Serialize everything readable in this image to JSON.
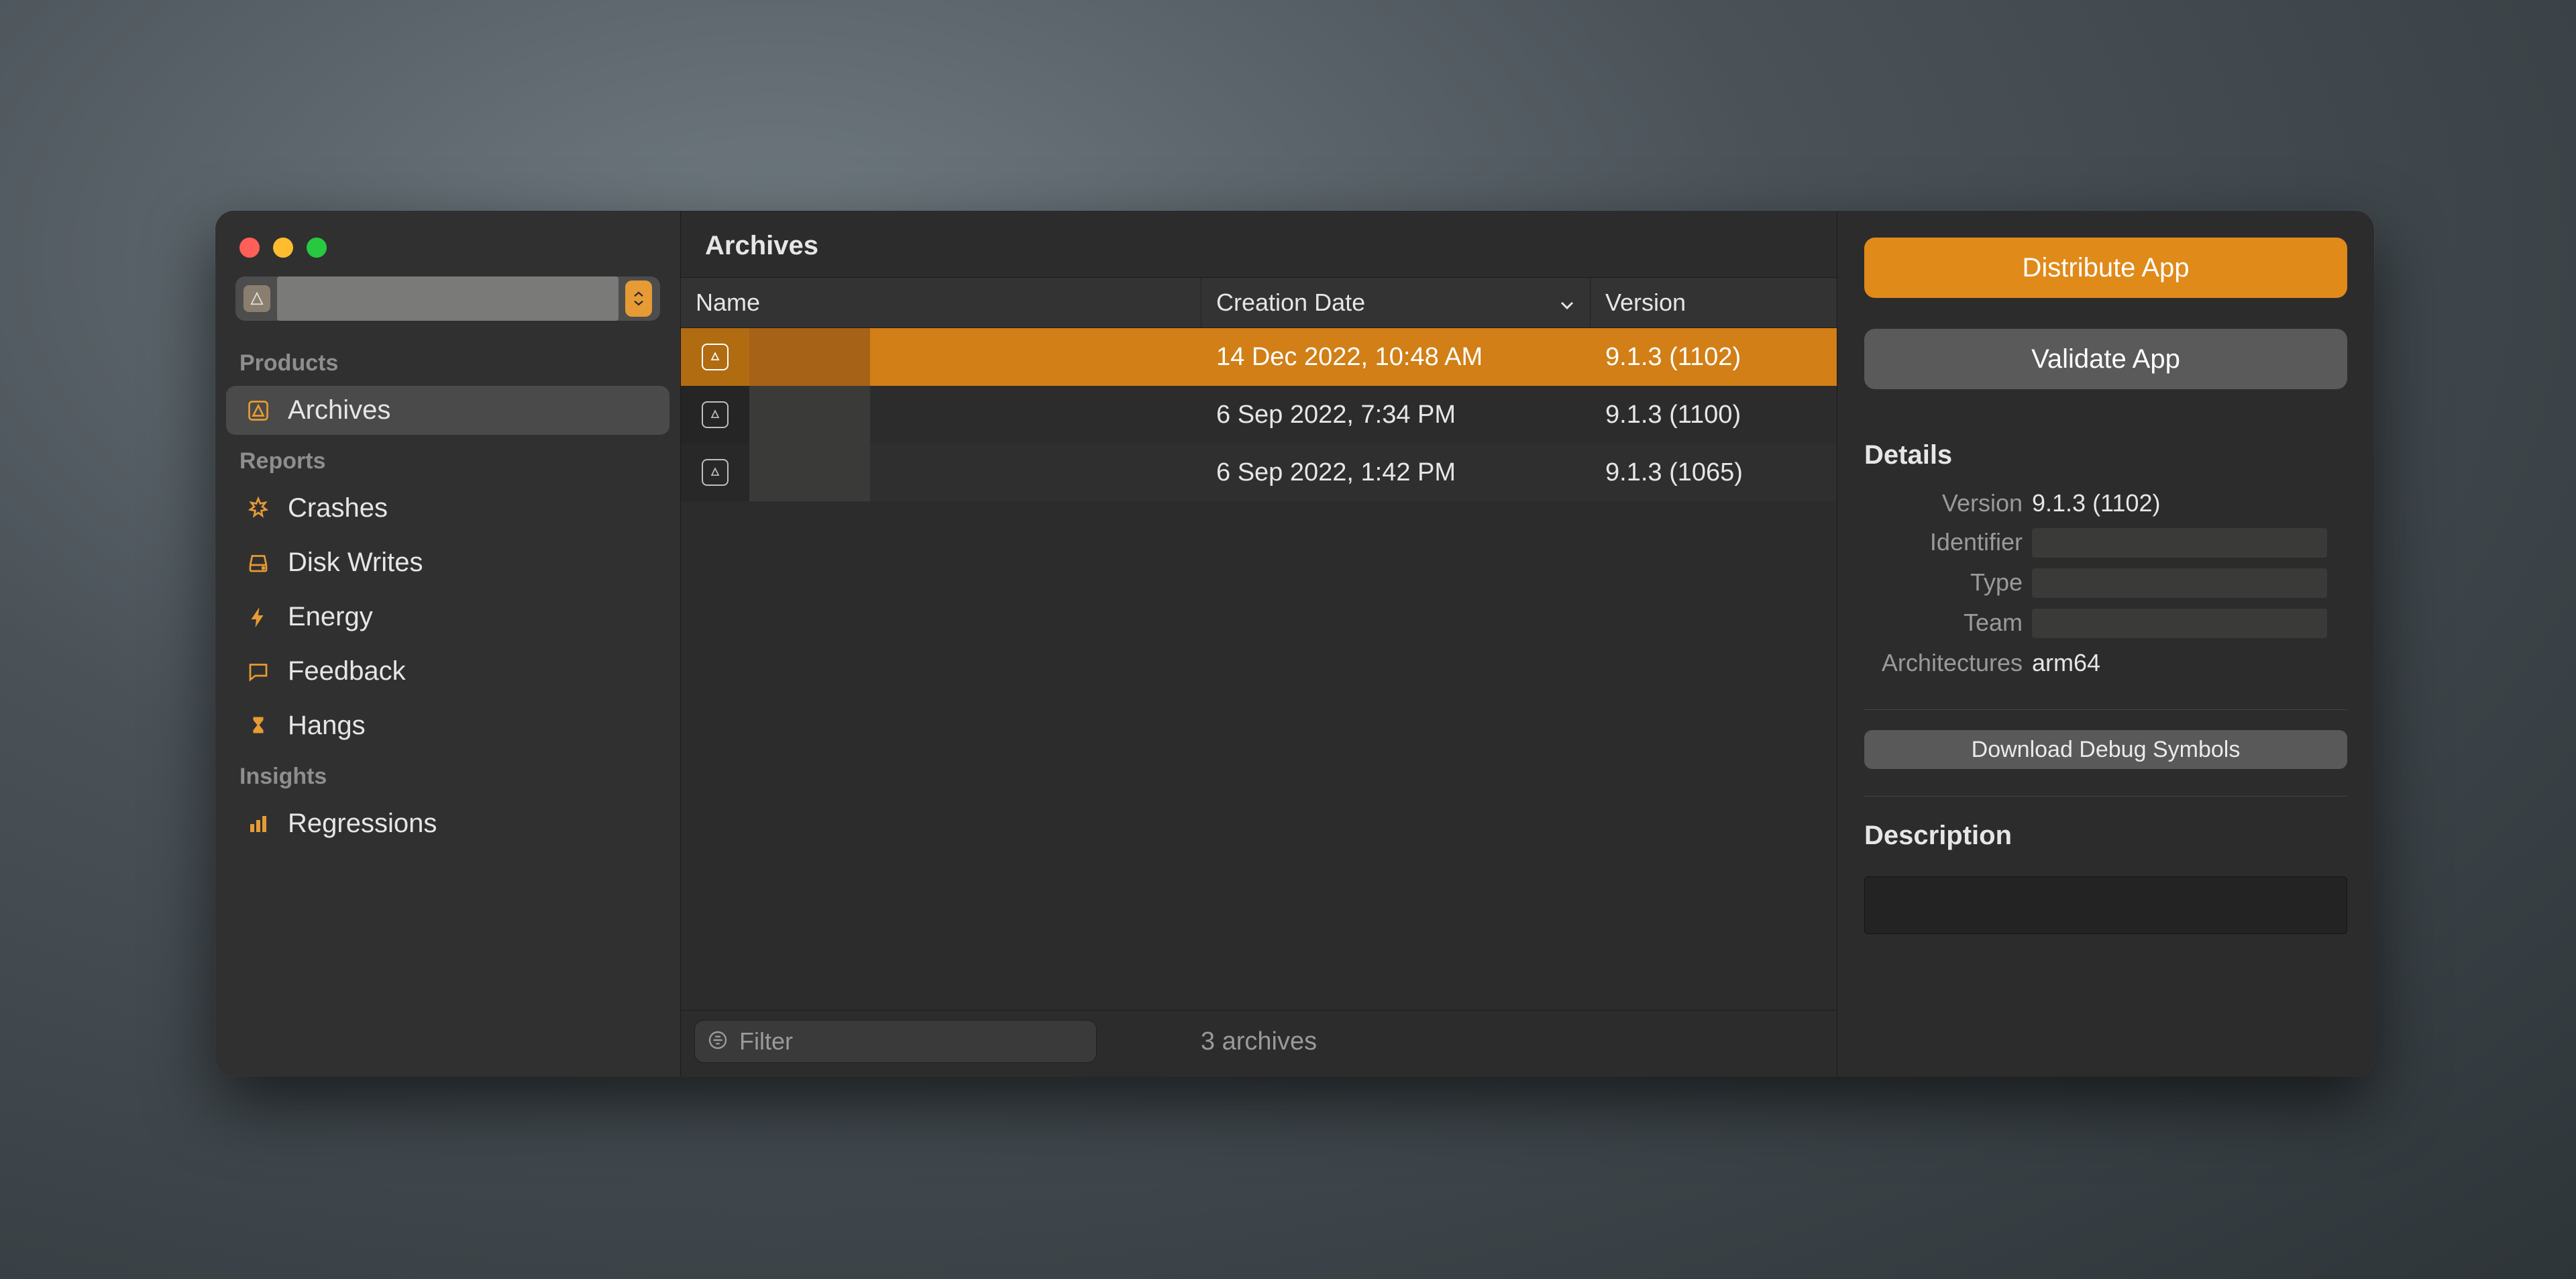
{
  "title": "Archives",
  "sidebar": {
    "sections": [
      {
        "heading": "Products",
        "items": [
          {
            "label": "Archives",
            "icon": "archive-icon",
            "selected": true
          }
        ]
      },
      {
        "heading": "Reports",
        "items": [
          {
            "label": "Crashes",
            "icon": "crash-icon",
            "selected": false
          },
          {
            "label": "Disk Writes",
            "icon": "disk-icon",
            "selected": false
          },
          {
            "label": "Energy",
            "icon": "energy-icon",
            "selected": false
          },
          {
            "label": "Feedback",
            "icon": "feedback-icon",
            "selected": false
          },
          {
            "label": "Hangs",
            "icon": "hourglass-icon",
            "selected": false
          }
        ]
      },
      {
        "heading": "Insights",
        "items": [
          {
            "label": "Regressions",
            "icon": "bars-icon",
            "selected": false
          }
        ]
      }
    ]
  },
  "table": {
    "columns": {
      "name": "Name",
      "date": "Creation Date",
      "version": "Version"
    },
    "sort_column": "date",
    "sort_dir": "desc",
    "rows": [
      {
        "name": "",
        "date": "14 Dec 2022, 10:48 AM",
        "version": "9.1.3 (1102)",
        "selected": true
      },
      {
        "name": "",
        "date": "6 Sep 2022, 7:34 PM",
        "version": "9.1.3 (1100)",
        "selected": false
      },
      {
        "name": "",
        "date": "6 Sep 2022, 1:42 PM",
        "version": "9.1.3 (1065)",
        "selected": false
      }
    ]
  },
  "footer": {
    "filter_placeholder": "Filter",
    "filter_value": "",
    "count_text": "3 archives"
  },
  "right": {
    "distribute_label": "Distribute App",
    "validate_label": "Validate App",
    "details_heading": "Details",
    "details": {
      "version_label": "Version",
      "version_value": "9.1.3 (1102)",
      "identifier_label": "Identifier",
      "identifier_value": "",
      "type_label": "Type",
      "type_value": "",
      "team_label": "Team",
      "team_value": "",
      "arch_label": "Architectures",
      "arch_value": "arm64"
    },
    "download_symbols_label": "Download Debug Symbols",
    "description_heading": "Description",
    "description_value": ""
  }
}
